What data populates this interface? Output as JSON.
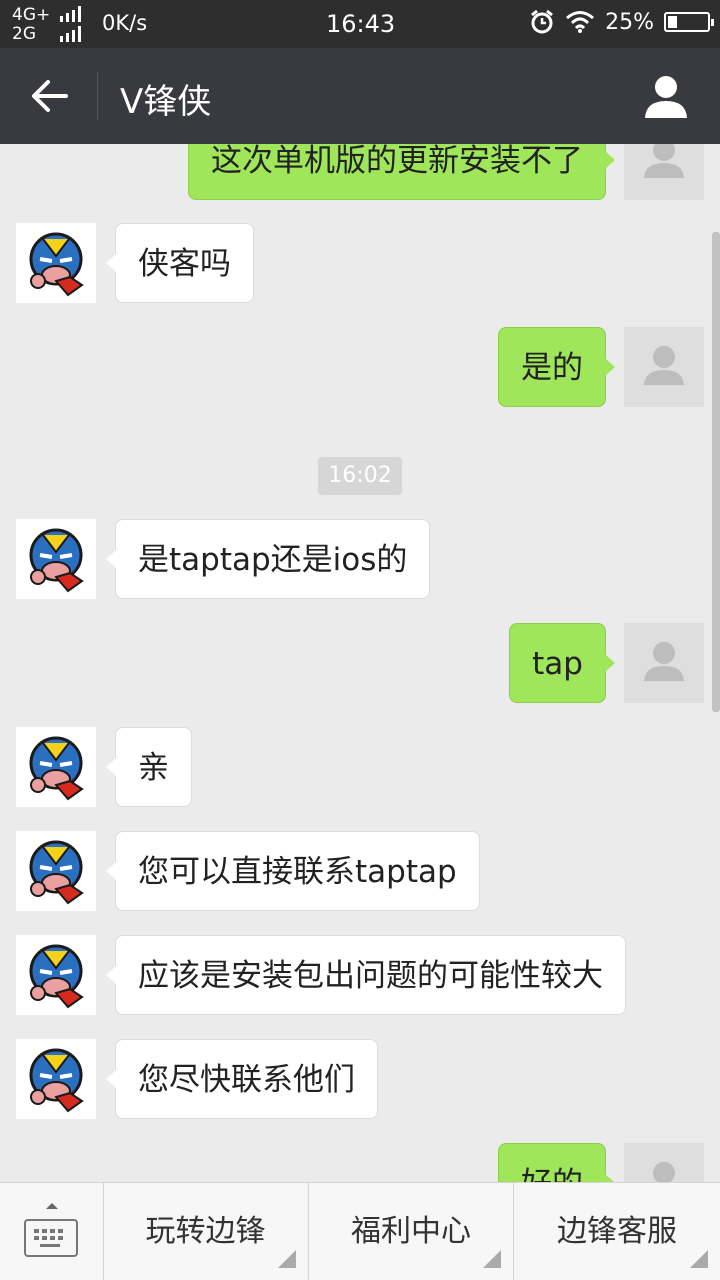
{
  "status_bar": {
    "network_top": "4G+",
    "network_bottom": "2G",
    "speed": "0K/s",
    "time": "16:43",
    "battery": "25%",
    "battery_level": 0.25
  },
  "header": {
    "title": "V锋侠",
    "back_icon": "arrow-left-icon",
    "profile_icon": "person-icon"
  },
  "messages": [
    {
      "side": "out",
      "text": "这次单机版的更新安装不了"
    },
    {
      "side": "in",
      "text": "侠客吗"
    },
    {
      "side": "out",
      "text": "是的"
    },
    {
      "time": "16:02"
    },
    {
      "side": "in",
      "text": "是taptap还是ios的"
    },
    {
      "side": "out",
      "text": "tap"
    },
    {
      "side": "in",
      "text": "亲"
    },
    {
      "side": "in",
      "text": "您可以直接联系taptap"
    },
    {
      "side": "in",
      "text": "应该是安装包出问题的可能性较大"
    },
    {
      "side": "in",
      "text": "您尽快联系他们"
    },
    {
      "side": "out",
      "text": "好的"
    }
  ],
  "bottom_menu": {
    "keyboard_icon": "keyboard-icon",
    "items": [
      "玩转边锋",
      "福利中心",
      "边锋客服"
    ]
  },
  "colors": {
    "title_bar": "#393a3f",
    "outgoing_bubble": "#9fe65a",
    "incoming_bubble": "#ffffff",
    "chat_background": "#ebebeb"
  }
}
